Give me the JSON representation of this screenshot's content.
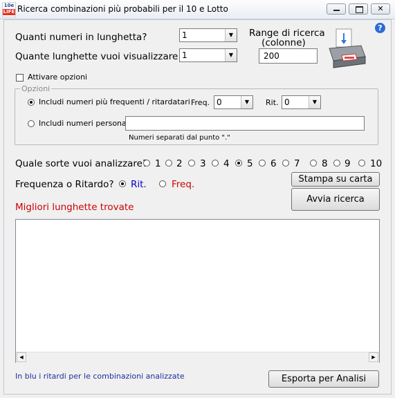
{
  "window": {
    "title": "Ricerca combinazioni più probabili per il 10 e Lotto",
    "icon_top": "10e",
    "icon_bottom": "LIFE",
    "minimize": "▁",
    "maximize": "□",
    "close": "✕"
  },
  "help_icon": "?",
  "form": {
    "qty_label": "Quanti numeri in lunghetta?",
    "qty_value": "1",
    "lines_label": "Quante lunghette vuoi visualizzare ?",
    "lines_value": "1",
    "range_label_1": "Range di ricerca",
    "range_label_2": "(colonne)",
    "range_value": "200"
  },
  "options": {
    "activate_label": "Attivare opzioni",
    "group_label": "Opzioni",
    "include_freq_label": "Includi numeri più frequenti / ritardatari",
    "freq_label": "Freq.",
    "freq_value": "0",
    "rit_label": "Rit.",
    "rit_value": "0",
    "include_personal_label": "Includi numeri personali",
    "personal_value": "",
    "personal_hint": "Numeri separati dal punto \".\""
  },
  "sorte": {
    "label": "Quale sorte vuoi analizzare?",
    "options": [
      "1",
      "2",
      "3",
      "4",
      "5",
      "6",
      "7",
      "8",
      "9",
      "10"
    ],
    "selected": "5"
  },
  "mode": {
    "label": "Frequenza o Ritardo?",
    "rit": "Rit.",
    "freq": "Freq.",
    "selected": "Rit.",
    "rit_color": "#0000cc",
    "freq_color": "#cc0000"
  },
  "buttons": {
    "print": "Stampa su carta",
    "search": "Avvia ricerca",
    "export": "Esporta per Analisi"
  },
  "results": {
    "title": "Migliori lunghette trovate",
    "title_color": "#cc0000",
    "items": []
  },
  "footer_note": "In blu i ritardi per le combinazioni analizzate",
  "footer_color": "#1a2fa0",
  "printer_icon": "printer-icon"
}
